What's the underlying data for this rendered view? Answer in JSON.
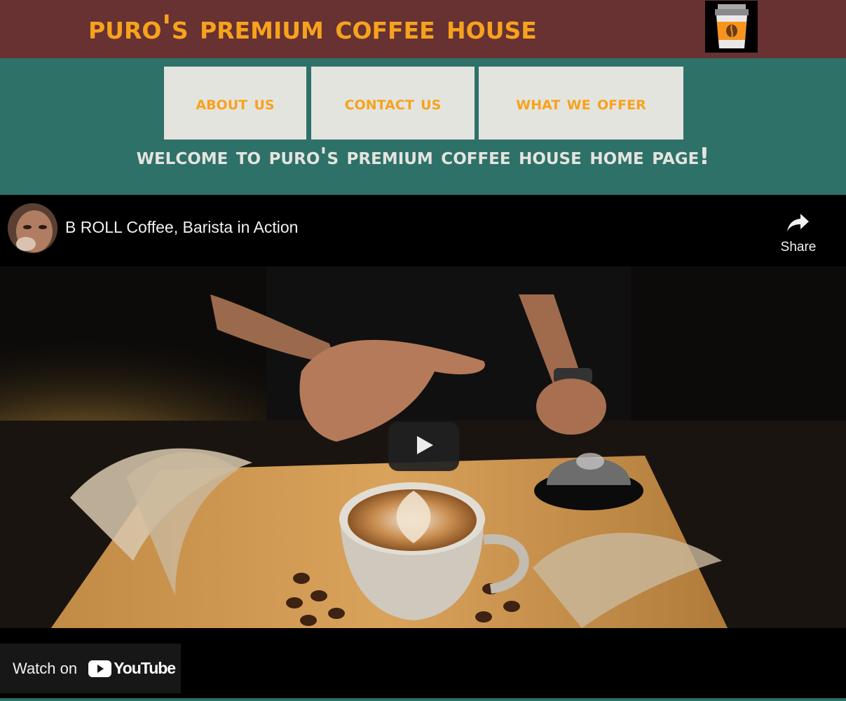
{
  "header": {
    "title": "Puro's Premium Coffee House",
    "logo_icon": "coffee-cup-icon"
  },
  "nav": {
    "items": [
      {
        "label": "About Us"
      },
      {
        "label": "Contact Us"
      },
      {
        "label": "What We Offer"
      }
    ]
  },
  "welcome": {
    "text": "Welcome to Puro's Premium Coffee House Home Page!"
  },
  "video": {
    "title": "B ROLL Coffee, Barista in Action",
    "share_label": "Share",
    "watch_on_label": "Watch on",
    "platform_name": "YouTube"
  },
  "colors": {
    "header_bg": "#673231",
    "accent_orange": "#f7a21e",
    "teal_bg": "#2e7169",
    "button_bg": "#e4e4de",
    "video_bg": "#000000"
  }
}
